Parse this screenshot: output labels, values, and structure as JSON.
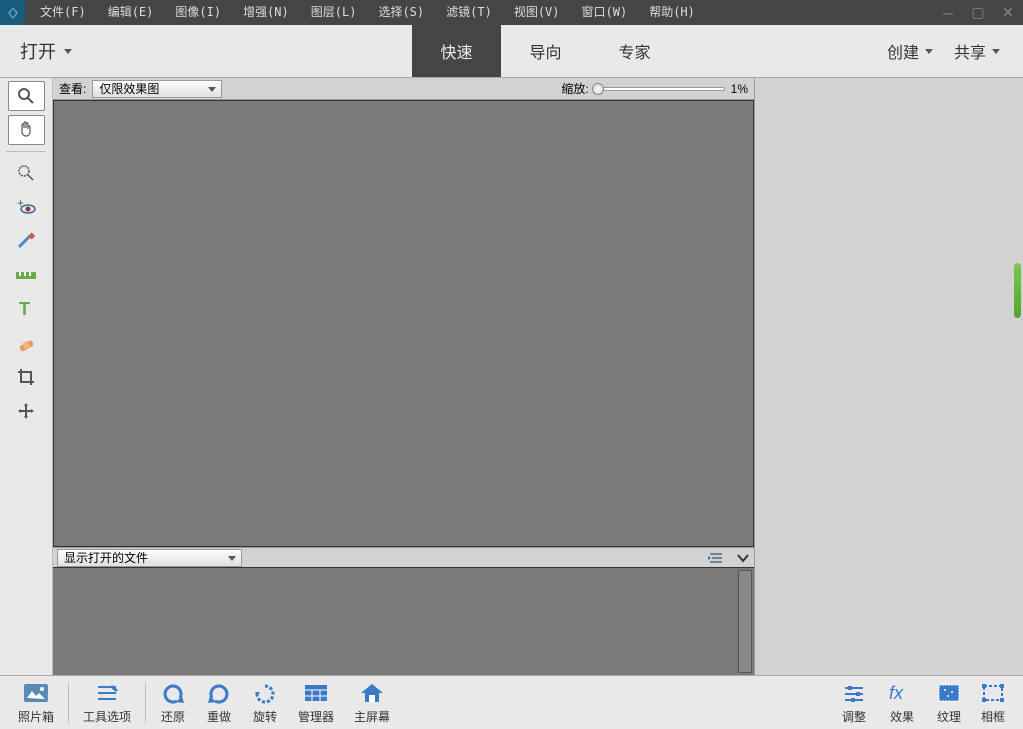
{
  "menu": [
    "文件(F)",
    "编辑(E)",
    "图像(I)",
    "增强(N)",
    "图层(L)",
    "选择(S)",
    "滤镜(T)",
    "视图(V)",
    "窗口(W)",
    "帮助(H)"
  ],
  "open_label": "打开",
  "tabs": {
    "quick": "快速",
    "guided": "导向",
    "expert": "专家"
  },
  "create_label": "创建",
  "share_label": "共享",
  "optbar": {
    "view_label": "查看:",
    "view_value": "仅限效果图",
    "zoom_label": "缩放:",
    "zoom_value": "1%"
  },
  "filebar": {
    "label": "显示打开的文件"
  },
  "bottom_left": [
    {
      "key": "photobin",
      "label": "照片箱"
    },
    {
      "key": "toolopts",
      "label": "工具选项"
    },
    {
      "key": "undo",
      "label": "还原"
    },
    {
      "key": "redo",
      "label": "重做"
    },
    {
      "key": "rotate",
      "label": "旋转"
    },
    {
      "key": "organizer",
      "label": "管理器"
    },
    {
      "key": "home",
      "label": "主屏幕"
    }
  ],
  "bottom_right": [
    {
      "key": "adjust",
      "label": "调整"
    },
    {
      "key": "effects",
      "label": "效果"
    },
    {
      "key": "textures",
      "label": "纹理"
    },
    {
      "key": "frames",
      "label": "相框"
    }
  ]
}
